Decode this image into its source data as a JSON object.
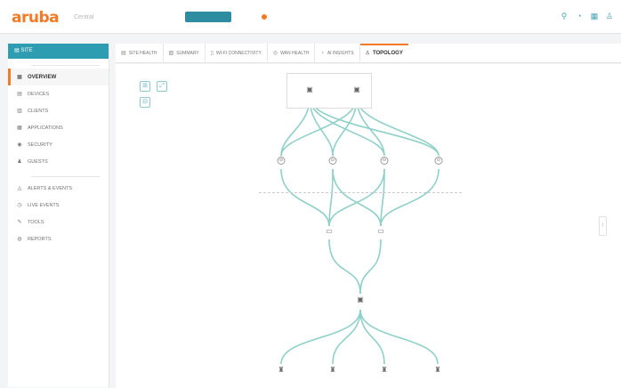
{
  "header": {
    "logo": "aruba",
    "logo_sub": "Central",
    "scope_label": "",
    "search_placeholder": ""
  },
  "sidebar": {
    "site_label": "SITE",
    "section1_label": "",
    "section2_label": "",
    "items_group1": [
      {
        "label": "OVERVIEW",
        "icon": "overview-icon",
        "glyph": "▦",
        "active": true
      },
      {
        "label": "DEVICES",
        "icon": "devices-icon",
        "glyph": "▤",
        "active": false
      },
      {
        "label": "CLIENTS",
        "icon": "clients-icon",
        "glyph": "▥",
        "active": false
      },
      {
        "label": "APPLICATIONS",
        "icon": "applications-icon",
        "glyph": "▦",
        "active": false
      },
      {
        "label": "SECURITY",
        "icon": "security-icon",
        "glyph": "◉",
        "active": false
      },
      {
        "label": "GUESTS",
        "icon": "guests-icon",
        "glyph": "♟",
        "active": false
      }
    ],
    "items_group2": [
      {
        "label": "ALERTS & EVENTS",
        "icon": "alerts-icon",
        "glyph": "◬",
        "active": false
      },
      {
        "label": "LIVE EVENTS",
        "icon": "live-events-icon",
        "glyph": "◷",
        "active": false
      },
      {
        "label": "TOOLS",
        "icon": "tools-icon",
        "glyph": "✎",
        "active": false
      },
      {
        "label": "REPORTS",
        "icon": "reports-icon",
        "glyph": "◍",
        "active": false
      }
    ]
  },
  "tabs": [
    {
      "label": "SITE HEALTH",
      "icon": "site-health-icon",
      "glyph": "▤",
      "active": false
    },
    {
      "label": "SUMMARY",
      "icon": "summary-icon",
      "glyph": "▧",
      "active": false
    },
    {
      "label": "WI-FI CONNECTIVITY",
      "icon": "wifi-connectivity-icon",
      "glyph": "▯",
      "active": false
    },
    {
      "label": "WAN HEALTH",
      "icon": "wan-health-icon",
      "glyph": "◎",
      "active": false
    },
    {
      "label": "AI INSIGHTS",
      "icon": "ai-insights-icon",
      "glyph": "♀",
      "active": false
    },
    {
      "label": "TOPOLOGY",
      "icon": "topology-icon",
      "glyph": "♙",
      "active": true
    }
  ],
  "topology": {
    "gateway_group_title": "",
    "gateways": [
      {
        "label": ""
      },
      {
        "label": ""
      }
    ],
    "level2": [
      {
        "label": ""
      },
      {
        "label": ""
      },
      {
        "label": ""
      },
      {
        "label": ""
      }
    ],
    "level3": [
      {
        "label": ""
      },
      {
        "label": ""
      }
    ],
    "level4": [
      {
        "label": ""
      }
    ],
    "level5": [
      {
        "label": ""
      },
      {
        "label": ""
      },
      {
        "label": ""
      },
      {
        "label": ""
      }
    ]
  },
  "colors": {
    "accent": "#f37a26",
    "teal": "#2f9db1",
    "link": "#8fd0c8"
  }
}
